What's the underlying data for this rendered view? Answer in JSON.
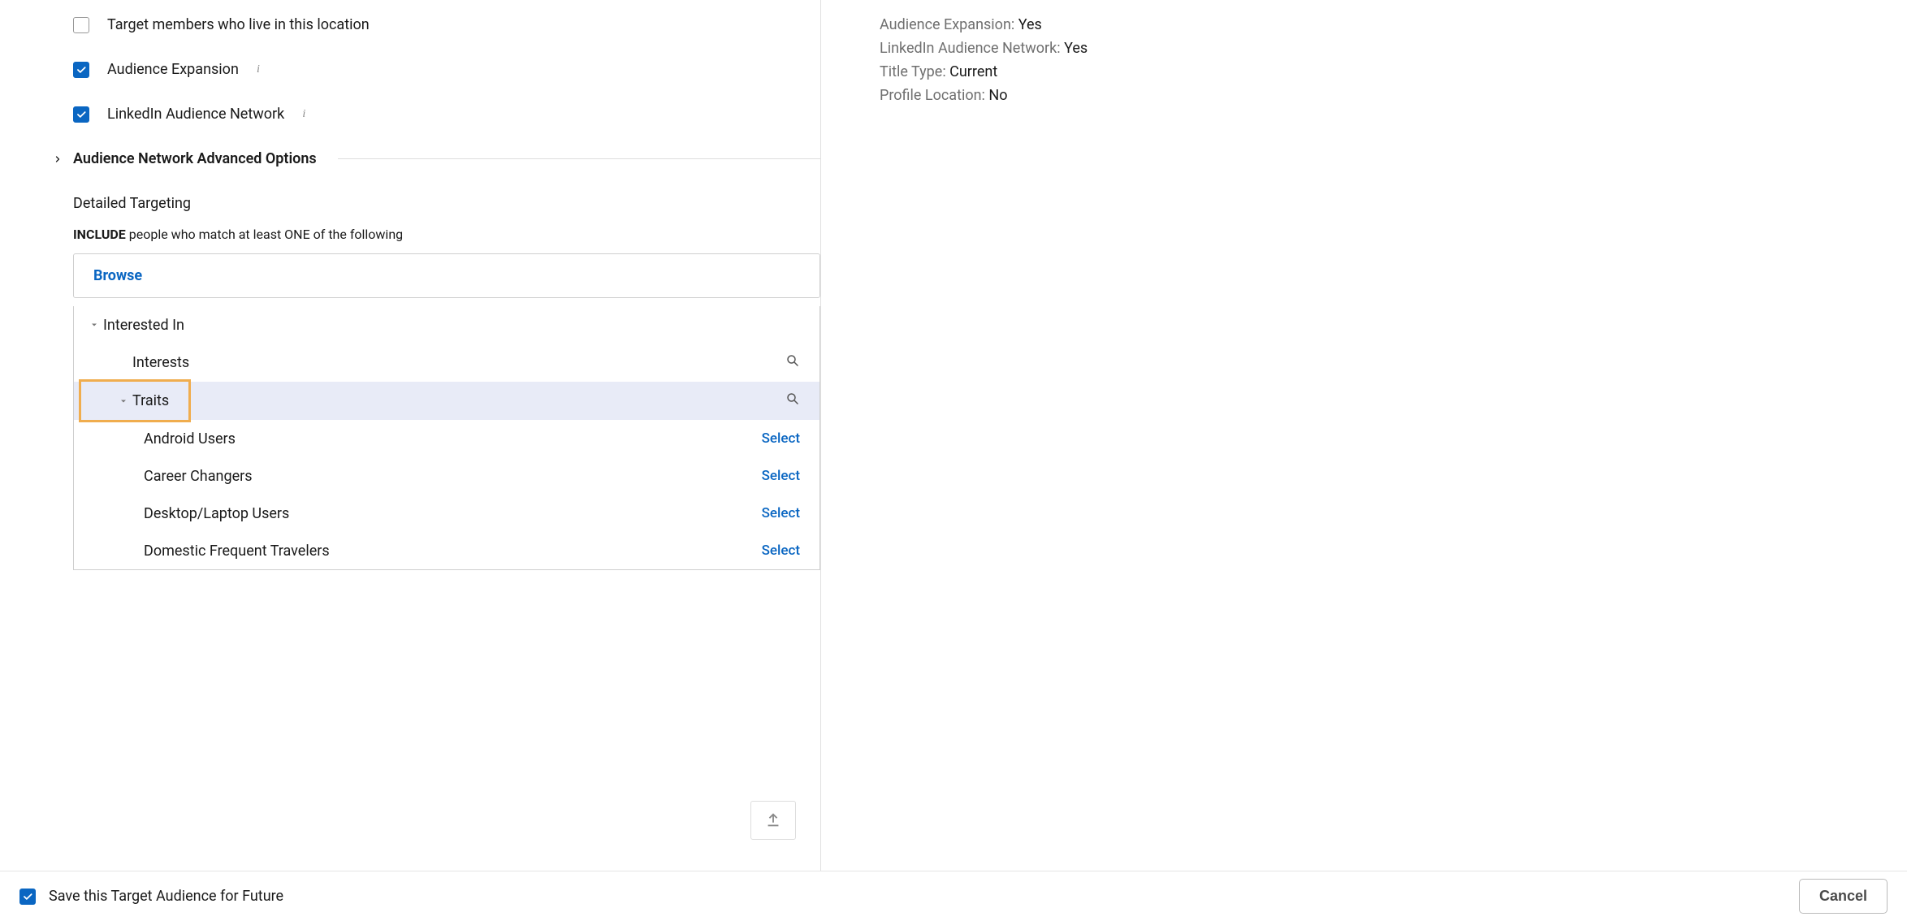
{
  "options": {
    "target_members": {
      "label": "Target members who live in this location",
      "checked": false
    },
    "audience_expansion": {
      "label": "Audience Expansion",
      "checked": true
    },
    "linkedin_network": {
      "label": "LinkedIn Audience Network",
      "checked": true
    }
  },
  "advanced_header": "Audience Network Advanced Options",
  "detailed_targeting": {
    "header": "Detailed Targeting",
    "include_bold": "INCLUDE",
    "include_rest": " people who match at least ONE of the following",
    "browse_label": "Browse"
  },
  "tree": {
    "parent": "Interested In",
    "child_interests": "Interests",
    "child_traits": "Traits",
    "leaves": [
      {
        "label": "Android Users",
        "action": "Select"
      },
      {
        "label": "Career Changers",
        "action": "Select"
      },
      {
        "label": "Desktop/Laptop Users",
        "action": "Select"
      },
      {
        "label": "Domestic Frequent Travelers",
        "action": "Select"
      }
    ]
  },
  "summary": [
    {
      "label": "Audience Expansion:",
      "value": "Yes"
    },
    {
      "label": "LinkedIn Audience Network:",
      "value": "Yes"
    },
    {
      "label": "Title Type:",
      "value": "Current"
    },
    {
      "label": "Profile Location:",
      "value": "No"
    }
  ],
  "footer": {
    "save_label": "Save this Target Audience for Future",
    "save_checked": true,
    "cancel": "Cancel"
  }
}
